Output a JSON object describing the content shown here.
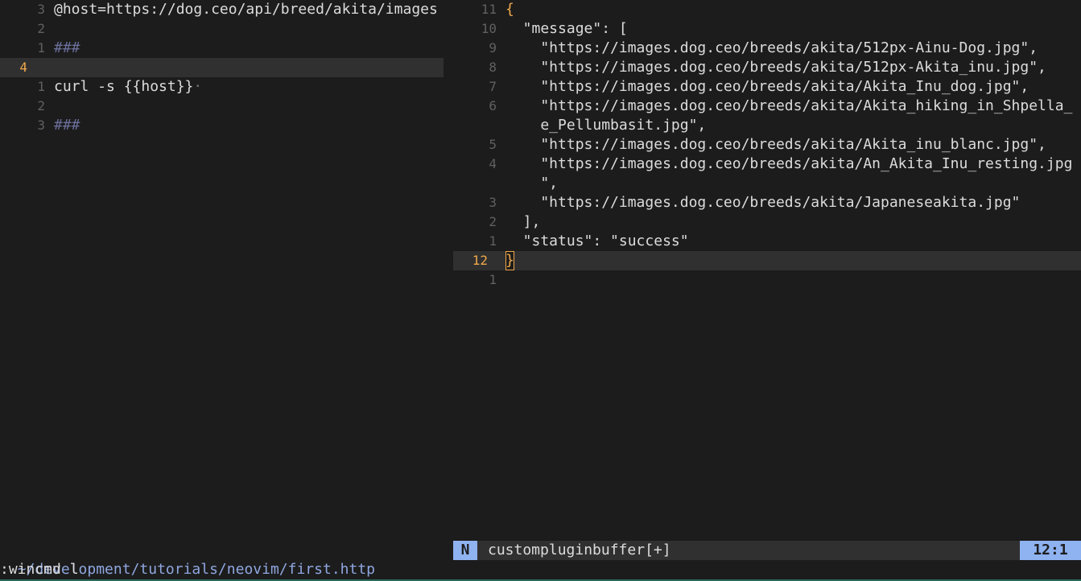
{
  "left_pane": {
    "lines": [
      {
        "num": "3",
        "text": "@host=https://dog.ceo/api/breed/akita/images"
      },
      {
        "num": "2",
        "text": ""
      },
      {
        "num": "1",
        "text": "###"
      },
      {
        "num": "4",
        "text": ""
      },
      {
        "num": "1",
        "text": "curl -s {{host}}"
      },
      {
        "num": "2",
        "text": ""
      },
      {
        "num": "3",
        "text": "###"
      }
    ],
    "trailing_marker": "·"
  },
  "right_pane": {
    "lines": [
      {
        "num": "11",
        "text": "{"
      },
      {
        "num": "10",
        "text": "  \"message\": ["
      },
      {
        "num": "9",
        "text": "    \"https://images.dog.ceo/breeds/akita/512px-Ainu-Dog.jpg\","
      },
      {
        "num": "8",
        "text": "    \"https://images.dog.ceo/breeds/akita/512px-Akita_inu.jpg\","
      },
      {
        "num": "7",
        "text": "    \"https://images.dog.ceo/breeds/akita/Akita_Inu_dog.jpg\","
      },
      {
        "num": "6",
        "text": "    \"https://images.dog.ceo/breeds/akita/Akita_hiking_in_Shpella_"
      },
      {
        "num": "",
        "text": "    e_Pellumbasit.jpg\","
      },
      {
        "num": "5",
        "text": "    \"https://images.dog.ceo/breeds/akita/Akita_inu_blanc.jpg\","
      },
      {
        "num": "4",
        "text": "    \"https://images.dog.ceo/breeds/akita/An_Akita_Inu_resting.jpg"
      },
      {
        "num": "",
        "text": "    \","
      },
      {
        "num": "3",
        "text": "    \"https://images.dog.ceo/breeds/akita/Japaneseakita.jpg\""
      },
      {
        "num": "2",
        "text": "  ],"
      },
      {
        "num": "1",
        "text": "  \"status\": \"success\""
      },
      {
        "num": "12",
        "text": "}"
      },
      {
        "num": "1",
        "text": ""
      }
    ]
  },
  "statusline": {
    "left_path": "~/development/tutorials/neovim/first.http",
    "mode": "N",
    "buffer_name": "custompluginbuffer[+]",
    "position": "12:1"
  },
  "cmdline": ":wincmd l",
  "colors": {
    "background": "#1c1c1c",
    "cursorline": "#303030",
    "current_line_number": "#f0a94b",
    "mode_badge": "#8fb2f0",
    "comment": "#6b6f9a"
  }
}
